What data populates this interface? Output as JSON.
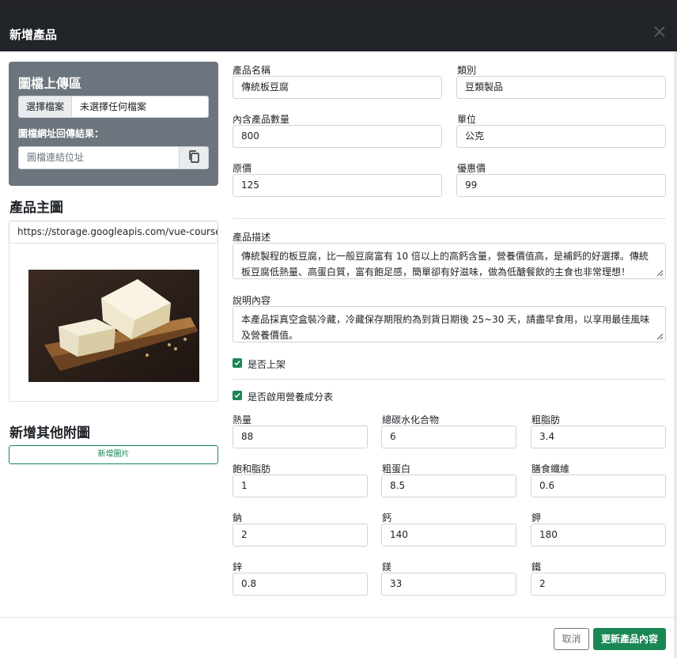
{
  "modal": {
    "title": "新增產品",
    "close_icon": "close-icon"
  },
  "upload": {
    "title": "圖檔上傳區",
    "file_button": "選擇檔案",
    "file_status": "未選擇任何檔案",
    "result_label": "圖檔網址回傳結果：",
    "url_placeholder": "圖檔連結位址",
    "copy_icon": "copy-icon"
  },
  "main_image": {
    "title": "產品主圖",
    "url": "https://storage.googleapis.com/vue-course-"
  },
  "other_images": {
    "title": "新增其他附圖",
    "add_button": "新增圖片"
  },
  "form": {
    "name": {
      "label": "產品名稱",
      "value": "傳統板豆腐"
    },
    "category": {
      "label": "類別",
      "value": "豆類製品"
    },
    "quantity": {
      "label": "內含產品數量",
      "value": "800"
    },
    "unit": {
      "label": "單位",
      "value": "公克"
    },
    "origin_price": {
      "label": "原價",
      "value": "125"
    },
    "price": {
      "label": "優惠價",
      "value": "99"
    },
    "description": {
      "label": "產品描述",
      "value": "傳統製程的板豆腐，比一般豆腐富有 10 倍以上的高鈣含量，營養價值高，是補鈣的好選擇。傳統板豆腐低熱量、高蛋白質，富有飽足感，簡單卻有好滋味，做為低醣餐飲的主食也非常理想！"
    },
    "content": {
      "label": "說明內容",
      "value": "本產品採真空盒裝冷藏，冷藏保存期限約為到貨日期後 25~30 天，請盡早食用，以享用最佳風味及營養價值。"
    },
    "is_enabled": {
      "label": "是否上架",
      "checked": true
    },
    "nutrition_enabled": {
      "label": "是否啟用營養成分表",
      "checked": true
    }
  },
  "nutrition": [
    {
      "label": "熱量",
      "value": "88"
    },
    {
      "label": "總碳水化合物",
      "value": "6"
    },
    {
      "label": "粗脂肪",
      "value": "3.4"
    },
    {
      "label": "飽和脂肪",
      "value": "1"
    },
    {
      "label": "粗蛋白",
      "value": "8.5"
    },
    {
      "label": "膳食纖維",
      "value": "0.6"
    },
    {
      "label": "鈉",
      "value": "2"
    },
    {
      "label": "鈣",
      "value": "140"
    },
    {
      "label": "鉀",
      "value": "180"
    },
    {
      "label": "鋅",
      "value": "0.8"
    },
    {
      "label": "鎂",
      "value": "33"
    },
    {
      "label": "鐵",
      "value": "2"
    }
  ],
  "footer": {
    "cancel": "取消",
    "submit": "更新產品內容"
  },
  "colors": {
    "header": "#212529",
    "upload_panel": "#6c757d",
    "success": "#198754"
  }
}
